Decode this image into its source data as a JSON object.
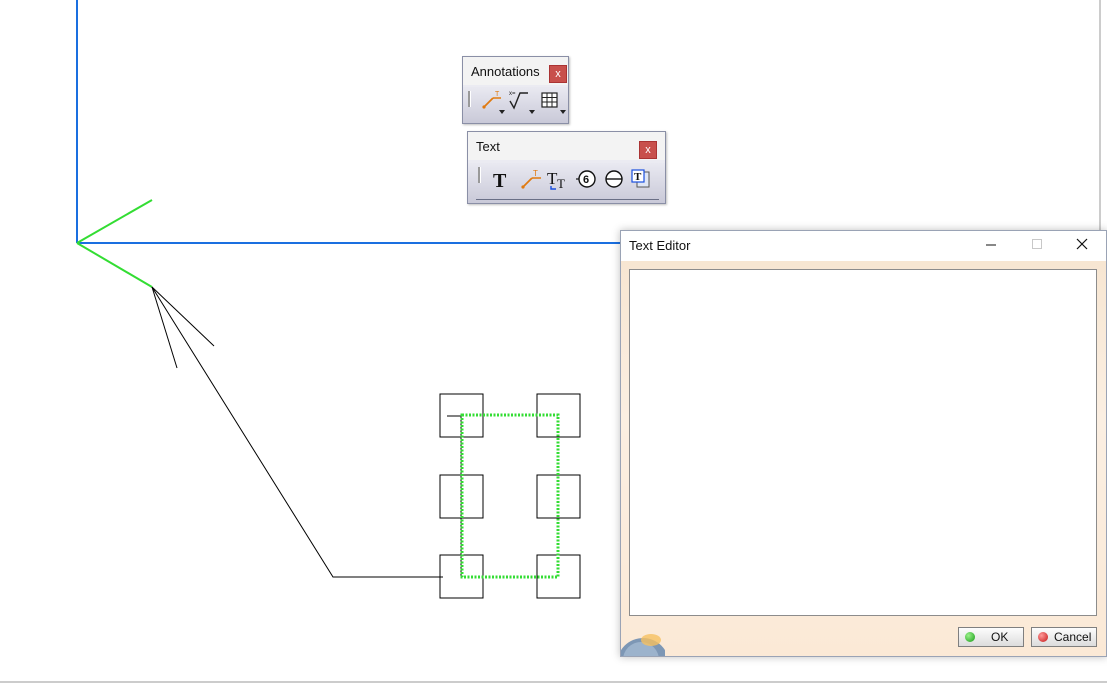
{
  "toolbars": {
    "annotations": {
      "title": "Annotations",
      "close_glyph": "x",
      "icons": [
        "leader-text-icon",
        "roughness-symbol-icon",
        "table-icon"
      ]
    },
    "text": {
      "title": "Text",
      "close_glyph": "x",
      "icons": [
        "text-icon",
        "text-with-leader-icon",
        "text-replicate-icon",
        "balloon-icon",
        "datum-target-icon",
        "text-template-icon"
      ],
      "balloon_label": "6"
    }
  },
  "text_editor": {
    "title": "Text Editor",
    "content": "",
    "ok_label": "OK",
    "cancel_label": "Cancel"
  },
  "colors": {
    "axis_blue": "#1a6fe0",
    "selection_green": "#33dd33",
    "close_red": "#c8504c"
  }
}
